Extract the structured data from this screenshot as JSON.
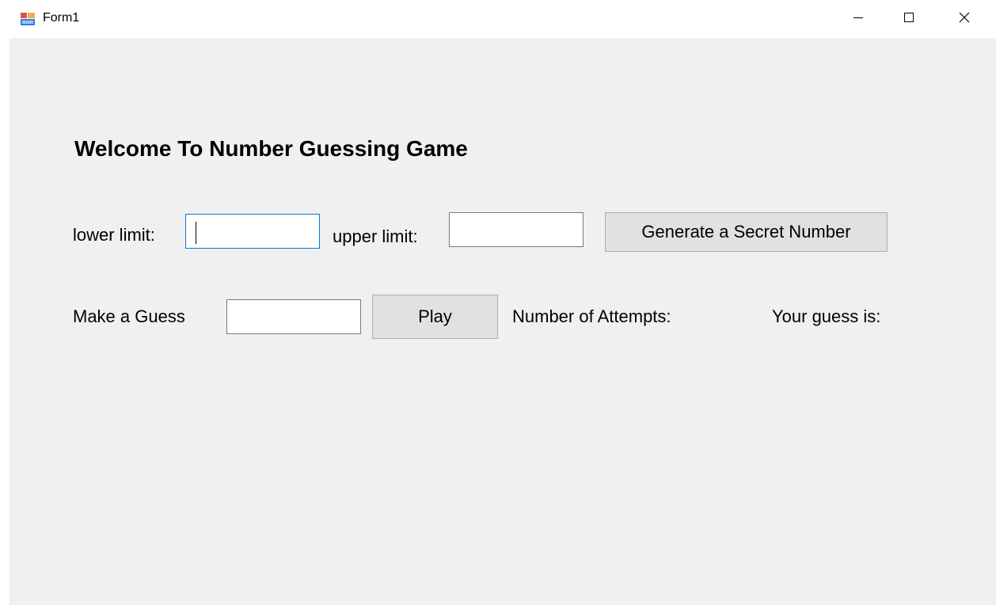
{
  "window": {
    "title": "Form1",
    "icon": "form-app-icon",
    "controls": {
      "minimize_icon": "minimize-icon",
      "maximize_icon": "maximize-icon",
      "close_icon": "close-icon"
    }
  },
  "form": {
    "heading": "Welcome To Number Guessing Game",
    "lower_limit": {
      "label": "lower limit:",
      "value": ""
    },
    "upper_limit": {
      "label": "upper limit:",
      "value": ""
    },
    "generate_button": "Generate a Secret Number",
    "guess": {
      "label": "Make a Guess",
      "value": ""
    },
    "play_button": "Play",
    "attempts_label": "Number of Attempts:",
    "result_label": "Your guess is:"
  },
  "colors": {
    "client_background": "#f0f0f0",
    "focus_border": "#0078d7",
    "button_face": "#e1e1e1"
  }
}
